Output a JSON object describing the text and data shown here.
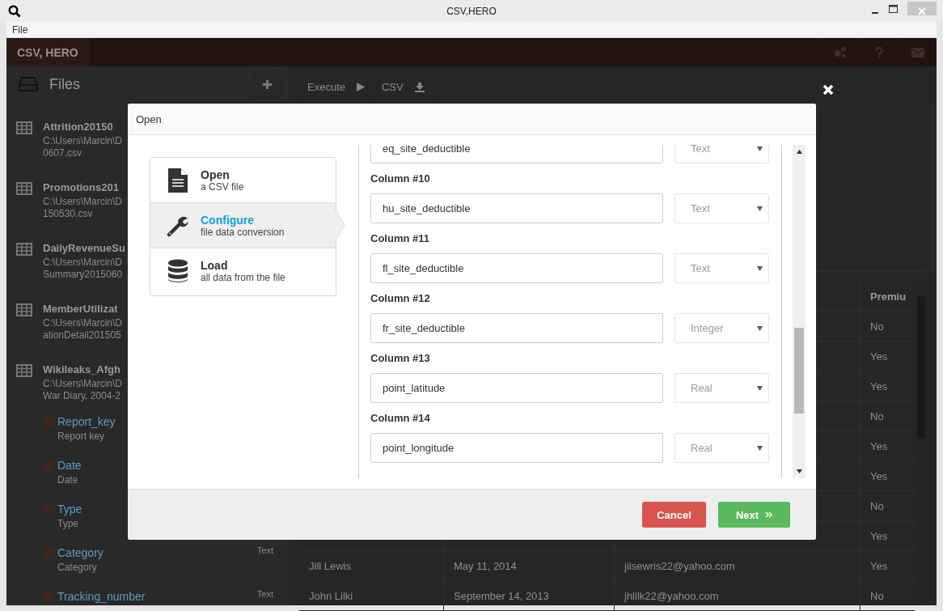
{
  "window": {
    "title": "CSV,HERO"
  },
  "menu": [
    "File"
  ],
  "app_bar": {
    "logo": "CSV, HERO"
  },
  "sidebar": {
    "title": "Files",
    "files": [
      {
        "name": "Attrition20150",
        "path_lines": [
          "C:\\Users\\Marcin\\D",
          "0607.csv"
        ]
      },
      {
        "name": "Promotions201",
        "path_lines": [
          "C:\\Users\\Marcin\\D",
          "150530.csv"
        ]
      },
      {
        "name": "DailyRevenueSu",
        "path_lines": [
          "C:\\Users\\Marcin\\D",
          "Summary2015060"
        ]
      },
      {
        "name": "MemberUtilizat",
        "path_lines": [
          "C:\\Users\\Marcin\\D",
          "ationDetail201505"
        ]
      },
      {
        "name": "Wikileaks_Afgh",
        "path_lines": [
          "C:\\Users\\Marcin\\D",
          "War Diary, 2004-2"
        ]
      }
    ],
    "fields": [
      {
        "name": "Report_key",
        "description": "Report key"
      },
      {
        "name": "Date",
        "description": "Date"
      },
      {
        "name": "Type",
        "description": "Type"
      },
      {
        "name": "Category",
        "description": "Category",
        "type": "Text"
      },
      {
        "name": "Tracking_number",
        "type": "Text"
      }
    ]
  },
  "toolbar": [
    {
      "kind": "play",
      "label": "Execute"
    },
    {
      "kind": "download",
      "label": "CSV"
    }
  ],
  "table": {
    "column_4_header": "Premiu",
    "rows": [
      {
        "column_4": "No"
      },
      {
        "column_4": "Yes"
      },
      {
        "column_4": "Yes"
      },
      {
        "column_4": "No"
      },
      {
        "column_4": "Yes"
      },
      {
        "column_4": "Yes"
      },
      {
        "column_4": "No"
      },
      {
        "column_4": "Yes"
      },
      {
        "column_1": "Jill Lewis",
        "column_2": "May 11, 2014",
        "column_3": "jilsewris22@yahoo.com",
        "column_4": "Yes"
      },
      {
        "column_1": "John Lilki",
        "column_2": "September 14, 2013",
        "column_3": "jhlilk22@yahoo.com",
        "column_4": "No"
      }
    ]
  },
  "dialog": {
    "title": "Open",
    "steps": [
      {
        "kind": "file",
        "title": "Open",
        "subtitle": "a CSV file",
        "selected": false
      },
      {
        "kind": "wrench",
        "title": "Configure",
        "subtitle": "file data conversion",
        "selected": true
      },
      {
        "kind": "database",
        "title": "Load",
        "subtitle": "all data from the file",
        "selected": false
      }
    ],
    "columns": [
      {
        "value": "eq_site_deductible",
        "type": "Text"
      },
      {
        "label": "Column #10",
        "value": "hu_site_deductible",
        "type": "Text"
      },
      {
        "label": "Column #11",
        "value": "fl_site_deductible",
        "type": "Text"
      },
      {
        "label": "Column #12",
        "value": "fr_site_deductible",
        "type": "Integer"
      },
      {
        "label": "Column #13",
        "value": "point_latitude",
        "type": "Real"
      },
      {
        "label": "Column #14",
        "value": "point_longitude",
        "type": "Real"
      }
    ],
    "buttons": [
      {
        "kind": "cancel",
        "label": "Cancel"
      },
      {
        "kind": "next",
        "label": "Next"
      }
    ]
  }
}
